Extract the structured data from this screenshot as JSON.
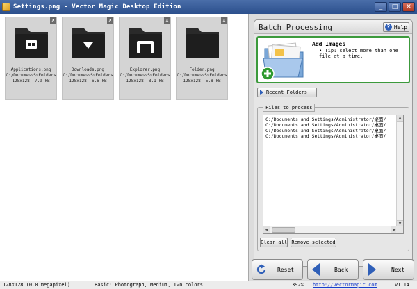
{
  "window": {
    "title": "Settings.png - Vector Magic Desktop Edition"
  },
  "gallery": {
    "items": [
      {
        "name": "Applications.png",
        "meta": "C:/Docume~~S~Folders",
        "size": "128x128, 7.9 kB",
        "icon": "applications-folder-icon"
      },
      {
        "name": "Downloads.png",
        "meta": "C:/Docume~~S~Folders",
        "size": "128x128, 6.6 kB",
        "icon": "downloads-folder-icon"
      },
      {
        "name": "Explorer.png",
        "meta": "C:/Docume~~S~Folders",
        "size": "128x128, 8.1 kB",
        "icon": "explorer-folder-icon"
      },
      {
        "name": "Folder.png",
        "meta": "C:/Docume~~S~Folders",
        "size": "128x128, 5.8 kB",
        "icon": "folder-icon"
      }
    ]
  },
  "panel": {
    "title": "Batch Processing",
    "help_label": "Help",
    "add_images": {
      "title": "Add Images",
      "tip": "• Tip: select more than one file at a time."
    },
    "recent_folders_label": "Recent Folders",
    "files_group_label": "Files to process",
    "files": [
      "C:/Documents and Settings/Administrator/桌面/",
      "C:/Documents and Settings/Administrator/桌面/",
      "C:/Documents and Settings/Administrator/桌面/",
      "C:/Documents and Settings/Administrator/桌面/"
    ],
    "clear_all_label": "Clear all",
    "remove_selected_label": "Remove selected"
  },
  "nav": {
    "reset_label": "Reset",
    "back_label": "Back",
    "next_label": "Next"
  },
  "status": {
    "image_info": "128x128 (0.0 megapixel)",
    "mode": "Basic: Photograph, Medium, Two colors",
    "zoom": "392%",
    "url": "http://vectormagic.com",
    "version": "v1.14"
  },
  "colors": {
    "titlebar": "#2b4f8c",
    "accent_green": "#3c9a3c",
    "accent_blue": "#2f5fb8"
  }
}
